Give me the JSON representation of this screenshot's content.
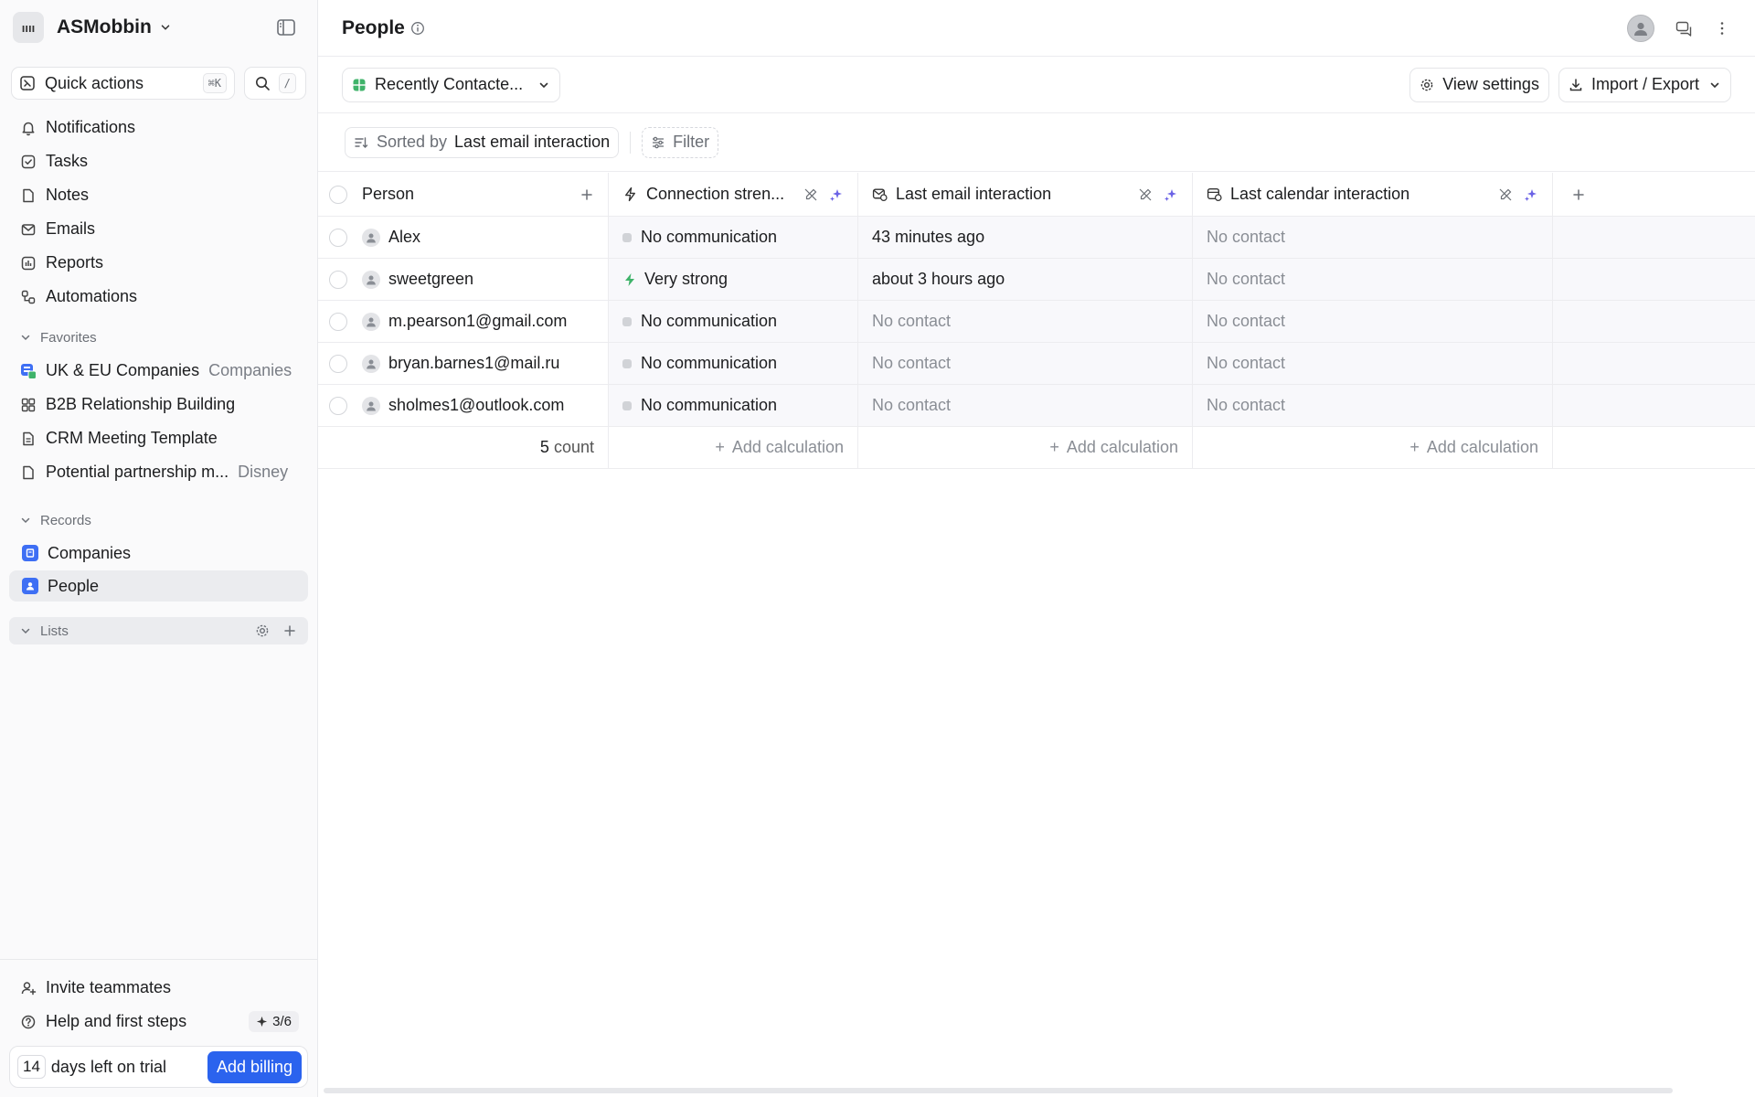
{
  "workspace": {
    "logo_text": "ıııı",
    "name": "ASMobbin"
  },
  "quick_actions": {
    "label": "Quick actions",
    "shortcut": "⌘K",
    "search_shortcut": "/"
  },
  "nav": {
    "items": [
      {
        "label": "Notifications",
        "icon": "bell-icon"
      },
      {
        "label": "Tasks",
        "icon": "check-square-icon"
      },
      {
        "label": "Notes",
        "icon": "file-icon"
      },
      {
        "label": "Emails",
        "icon": "mail-icon"
      },
      {
        "label": "Reports",
        "icon": "chart-icon"
      },
      {
        "label": "Automations",
        "icon": "workflow-icon"
      }
    ]
  },
  "favorites": {
    "title": "Favorites",
    "items": [
      {
        "label": "UK & EU Companies",
        "sub": "Companies"
      },
      {
        "label": "B2B Relationship Building",
        "sub": ""
      },
      {
        "label": "CRM Meeting Template",
        "sub": ""
      },
      {
        "label": "Potential partnership m...",
        "sub": "Disney"
      }
    ]
  },
  "records": {
    "title": "Records",
    "items": [
      {
        "label": "Companies"
      },
      {
        "label": "People"
      }
    ]
  },
  "lists": {
    "title": "Lists"
  },
  "bottom": {
    "invite": "Invite teammates",
    "help": "Help and first steps",
    "steps": "3/6",
    "trial_days": "14",
    "trial_text": "days left on trial",
    "billing_button": "Add billing"
  },
  "header": {
    "title": "People"
  },
  "view": {
    "name": "Recently Contacte...",
    "settings_label": "View settings",
    "import_export_label": "Import / Export"
  },
  "sort": {
    "prefix": "Sorted by",
    "field": "Last email interaction",
    "filter_label": "Filter"
  },
  "table": {
    "columns": {
      "person": "Person",
      "connection": "Connection stren...",
      "email": "Last email interaction",
      "calendar": "Last calendar interaction"
    },
    "rows": [
      {
        "name": "Alex",
        "connection": "No communication",
        "strong": false,
        "email": "43 minutes ago",
        "email_muted": false,
        "calendar": "No contact"
      },
      {
        "name": "sweetgreen",
        "connection": "Very strong",
        "strong": true,
        "email": "about 3 hours ago",
        "email_muted": false,
        "calendar": "No contact"
      },
      {
        "name": "m.pearson1@gmail.com",
        "connection": "No communication",
        "strong": false,
        "email": "No contact",
        "email_muted": true,
        "calendar": "No contact"
      },
      {
        "name": "bryan.barnes1@mail.ru",
        "connection": "No communication",
        "strong": false,
        "email": "No contact",
        "email_muted": true,
        "calendar": "No contact"
      },
      {
        "name": "sholmes1@outlook.com",
        "connection": "No communication",
        "strong": false,
        "email": "No contact",
        "email_muted": true,
        "calendar": "No contact"
      }
    ],
    "footer": {
      "count_number": "5",
      "count_label": "count",
      "add_calculation": "Add calculation"
    }
  },
  "colors": {
    "accent": "#2b63ee",
    "strong_green": "#3fb36a",
    "record_blue": "#3e6ff4",
    "ai_purple": "#6b63e6"
  }
}
